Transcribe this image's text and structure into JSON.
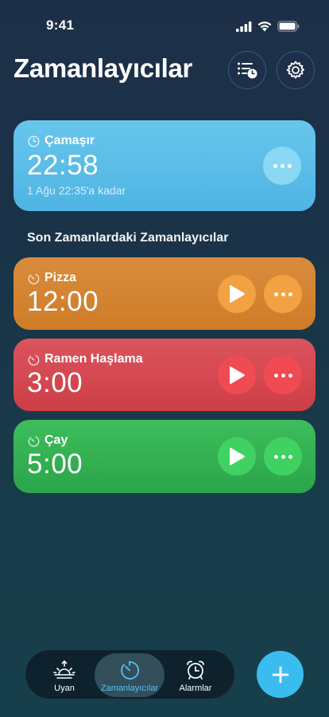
{
  "status": {
    "time": "9:41"
  },
  "header": {
    "title": "Zamanlayıcılar"
  },
  "active_timer": {
    "name": "Çamaşır",
    "time": "22:58",
    "until": "1 Ağu 22:35'a kadar",
    "color": "#5ab9e6"
  },
  "recent": {
    "section_title": "Son Zamanlardaki Zamanlayıcılar",
    "timers": [
      {
        "name": "Pizza",
        "time": "12:00",
        "color": "#d4843a"
      },
      {
        "name": "Ramen Haşlama",
        "time": "3:00",
        "color": "#d64a52"
      },
      {
        "name": "Çay",
        "time": "5:00",
        "color": "#36b354"
      }
    ]
  },
  "tabs": [
    {
      "label": "Uyan",
      "icon": "sunrise-icon"
    },
    {
      "label": "Zamanlayıcılar",
      "icon": "timer-icon",
      "active": true
    },
    {
      "label": "Alarmlar",
      "icon": "alarm-clock-icon"
    }
  ],
  "accent": "#3bbcef"
}
